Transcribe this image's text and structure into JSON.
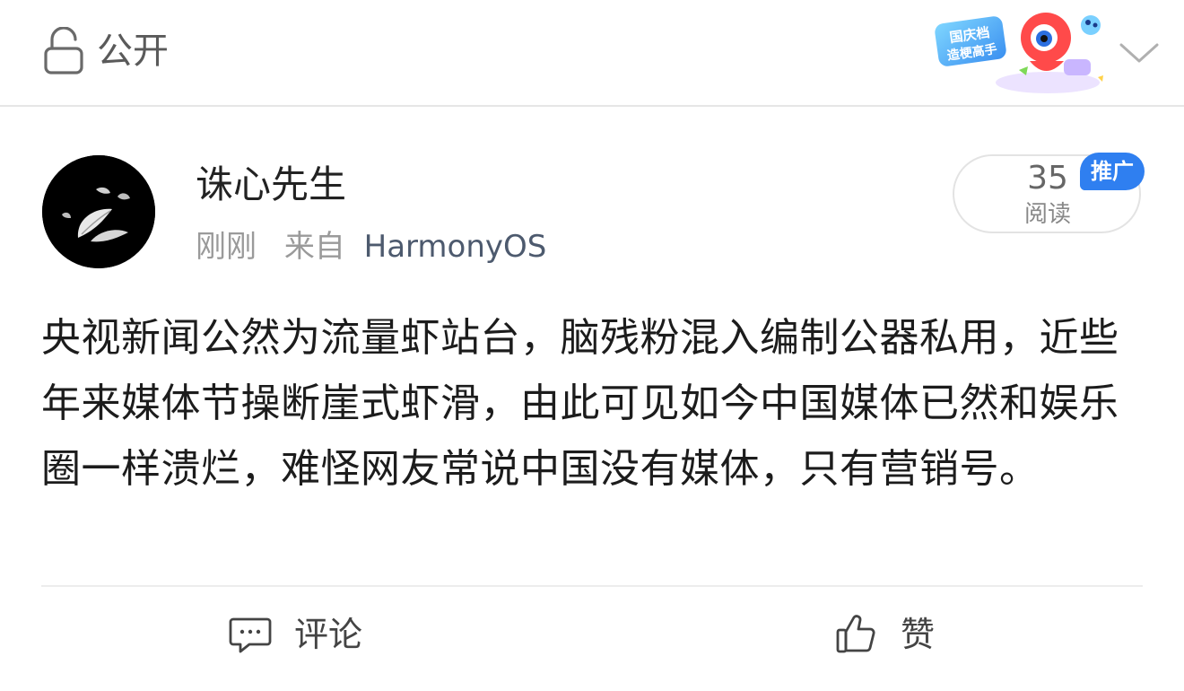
{
  "header": {
    "visibility_label": "公开",
    "lock_icon": "lock-open-icon",
    "promo_badge_text_line1": "国庆档",
    "promo_badge_text_line2": "造梗高手",
    "collapse_icon": "chevron-down-icon"
  },
  "post": {
    "author_name": "诛心先生",
    "time": "刚刚",
    "source_prefix": "来自",
    "source": "HarmonyOS",
    "read_count": "35",
    "read_label": "阅读",
    "ad_badge": "推广",
    "body": "央视新闻公然为流量虾站台，脑残粉混入编制公器私用，近些年来媒体节操断崖式虾滑，由此可见如今中国媒体已然和娱乐圈一样溃烂，难怪网友常说中国没有媒体，只有营销号。"
  },
  "actions": {
    "comment_label": "评论",
    "comment_icon": "comment-icon",
    "like_label": "赞",
    "like_icon": "thumbs-up-icon"
  },
  "colors": {
    "accent_blue": "#2f7ff0",
    "source_text": "#4d5a6e",
    "meta_text": "#9a9a9a"
  }
}
